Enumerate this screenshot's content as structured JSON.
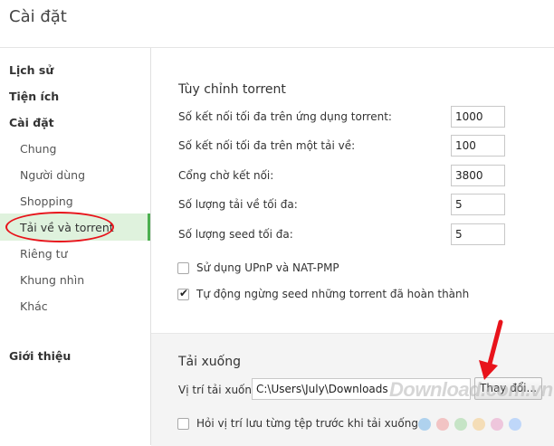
{
  "header": {
    "title": "Cài đặt"
  },
  "sidebar": {
    "items": [
      {
        "label": "Lịch sử"
      },
      {
        "label": "Tiện ích"
      },
      {
        "label": "Cài đặt"
      },
      {
        "label": "Chung"
      },
      {
        "label": "Người dùng"
      },
      {
        "label": "Shopping"
      },
      {
        "label": "Tải về và torrent"
      },
      {
        "label": "Riêng tư"
      },
      {
        "label": "Khung nhìn"
      },
      {
        "label": "Khác"
      },
      {
        "label": "Giới thiệu"
      }
    ],
    "selected_index": 6
  },
  "torrent": {
    "title": "Tùy chỉnh torrent",
    "fields": [
      {
        "label": "Số kết nối tối đa trên ứng dụng torrent:",
        "value": "1000"
      },
      {
        "label": "Số kết nối tối đa trên một tải về:",
        "value": "100"
      },
      {
        "label": "Cổng chờ kết nối:",
        "value": "3800"
      },
      {
        "label": "Số lượng tải về tối đa:",
        "value": "5"
      },
      {
        "label": "Số lượng seed tối đa:",
        "value": "5"
      }
    ],
    "checkboxes": [
      {
        "label": "Sử dụng UPnP và NAT-PMP",
        "checked": false
      },
      {
        "label": "Tự động ngừng seed những torrent đã hoàn thành",
        "checked": true
      }
    ]
  },
  "download": {
    "title": "Tải xuống",
    "location_label": "Vị trí tải xuống:",
    "location_value": "C:\\Users\\July\\Downloads",
    "change_button": "Thay đổi...",
    "ask_checkbox": {
      "label": "Hỏi vị trí lưu từng tệp trước khi tải xuống",
      "checked": false
    }
  },
  "watermark": {
    "text": "Download.com.vn"
  },
  "colors": {
    "selected_bg": "#dff2dd",
    "selected_bar": "#4caf50",
    "annotation_red": "#e8131b"
  }
}
